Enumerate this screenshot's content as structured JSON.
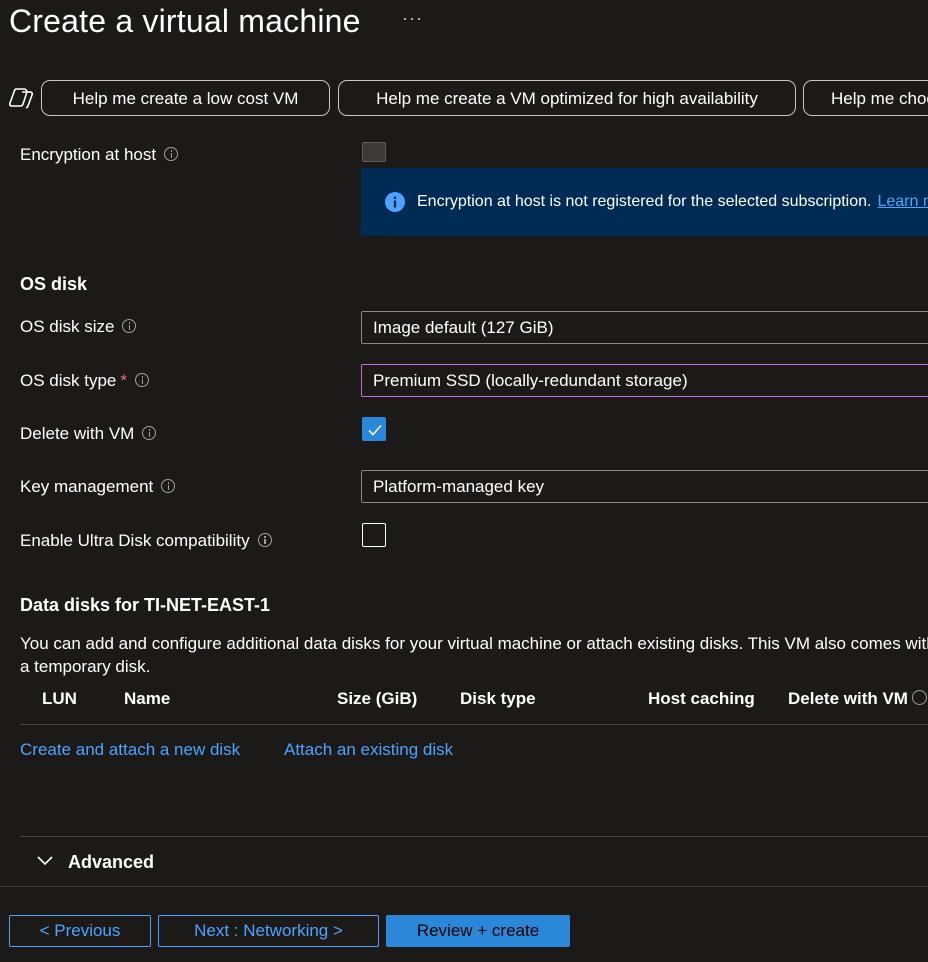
{
  "page": {
    "title": "Create a virtual machine",
    "more_label": "···"
  },
  "copilot": {
    "icon": "copilot-icon",
    "prompts": [
      "Help me create a low cost VM",
      "Help me create a VM optimized for high availability",
      "Help me choose the right VM size for my workload"
    ]
  },
  "encryption": {
    "label": "Encryption at host",
    "checked": false,
    "disabled": true,
    "notice": "Encryption at host is not registered for the selected subscription.",
    "notice_link": "Learn more"
  },
  "os_disk": {
    "heading": "OS disk",
    "size_label": "OS disk size",
    "size_value": "Image default (127 GiB)",
    "type_label": "OS disk type",
    "type_required": "*",
    "type_value": "Premium SSD (locally-redundant storage)",
    "delete_label": "Delete with VM",
    "delete_checked": true,
    "key_label": "Key management",
    "key_value": "Platform-managed key",
    "ultra_label": "Enable Ultra Disk compatibility",
    "ultra_checked": false
  },
  "data_disks": {
    "heading": "Data disks for TI-NET-EAST-1",
    "description": "You can add and configure additional data disks for your virtual machine or attach existing disks. This VM also comes with a temporary disk.",
    "columns": [
      "LUN",
      "Name",
      "Size (GiB)",
      "Disk type",
      "Host caching",
      "Delete with VM"
    ],
    "rows": [],
    "create_link": "Create and attach a new disk",
    "attach_link": "Attach an existing disk"
  },
  "advanced": {
    "label": "Advanced",
    "expanded": false
  },
  "footer": {
    "previous": "< Previous",
    "next": "Next : Networking >",
    "review": "Review + create"
  },
  "colors": {
    "background": "#1b1a19",
    "accent": "#2b88d8",
    "link": "#4fa3ff",
    "info_box": "#002b54",
    "focus_border": "#c36fd9",
    "required": "#f1707b"
  }
}
